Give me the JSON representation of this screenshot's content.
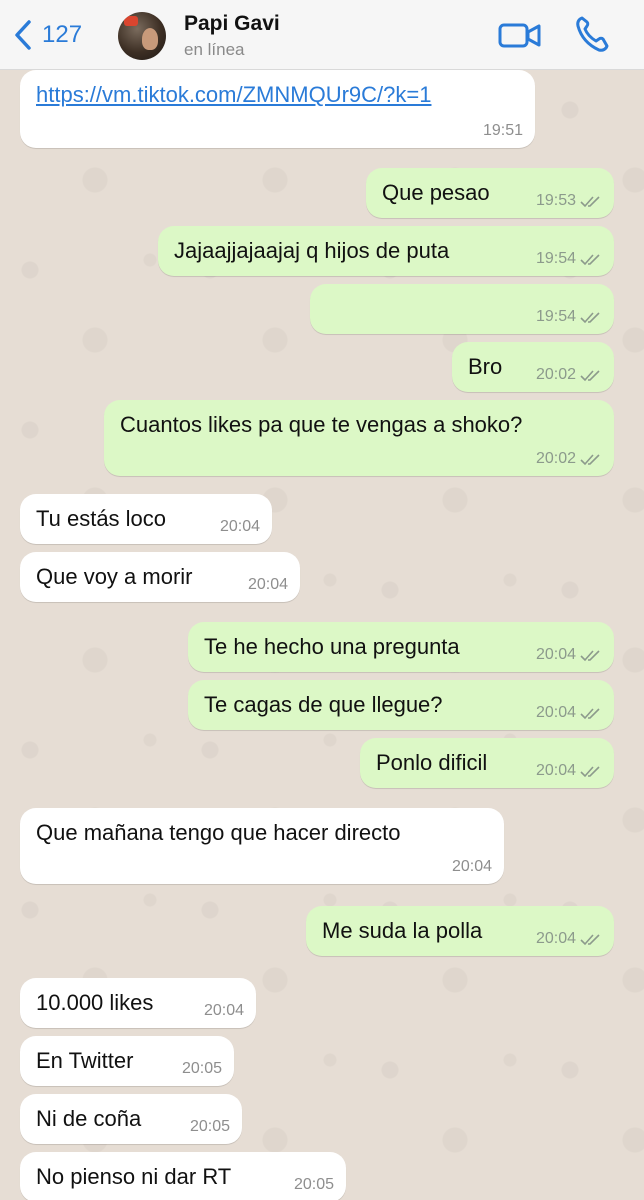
{
  "header": {
    "back_count": "127",
    "contact_name": "Papi Gavi",
    "status": "en línea"
  },
  "messages": [
    {
      "dir": "in",
      "text": "https://vm.tiktok.com/ZMNMQUr9C/?k=1",
      "time": "19:51",
      "is_link": true
    },
    {
      "dir": "out",
      "text": "Que pesao",
      "time": "19:53"
    },
    {
      "dir": "out",
      "text": "Jajaajjajaajaj q hijos de puta",
      "time": "19:54"
    },
    {
      "dir": "out",
      "text": "",
      "time": "19:54"
    },
    {
      "dir": "out",
      "text": "Bro",
      "time": "20:02"
    },
    {
      "dir": "out",
      "text": "Cuantos likes pa que te vengas a shoko?",
      "time": "20:02"
    },
    {
      "dir": "in",
      "text": "Tu estás loco",
      "time": "20:04"
    },
    {
      "dir": "in",
      "text": "Que voy a morir",
      "time": "20:04"
    },
    {
      "dir": "out",
      "text": "Te he hecho una pregunta",
      "time": "20:04"
    },
    {
      "dir": "out",
      "text": "Te cagas de que llegue?",
      "time": "20:04"
    },
    {
      "dir": "out",
      "text": "Ponlo dificil",
      "time": "20:04"
    },
    {
      "dir": "in",
      "text": "Que mañana tengo que hacer directo",
      "time": "20:04"
    },
    {
      "dir": "out",
      "text": "Me suda la polla",
      "time": "20:04"
    },
    {
      "dir": "in",
      "text": "10.000 likes",
      "time": "20:04"
    },
    {
      "dir": "in",
      "text": "En Twitter",
      "time": "20:05"
    },
    {
      "dir": "in",
      "text": "Ni de coña",
      "time": "20:05"
    },
    {
      "dir": "in",
      "text": "No pienso ni dar RT",
      "time": "20:05"
    }
  ],
  "colors": {
    "accent": "#2a7bd8",
    "outgoing_bubble": "#dcf8c6",
    "incoming_bubble": "#ffffff",
    "chat_background": "#e6ddd4"
  }
}
